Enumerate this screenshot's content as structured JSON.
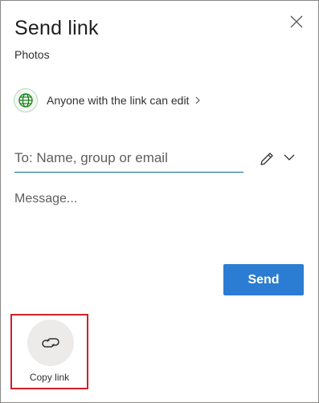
{
  "dialog": {
    "title": "Send link",
    "subtitle": "Photos"
  },
  "permission": {
    "label": "Anyone with the link can edit",
    "icon": "globe-icon",
    "accent_color": "#107c10"
  },
  "recipients": {
    "placeholder": "To: Name, group or email",
    "value": "",
    "edit_icon": "pencil-icon",
    "dropdown_icon": "chevron-down-icon"
  },
  "message": {
    "placeholder": "Message...",
    "value": ""
  },
  "actions": {
    "send_label": "Send",
    "send_color": "#2b7cd3",
    "copy_link_label": "Copy link",
    "copy_link_icon": "link-icon",
    "highlight_color": "#d0202a"
  }
}
